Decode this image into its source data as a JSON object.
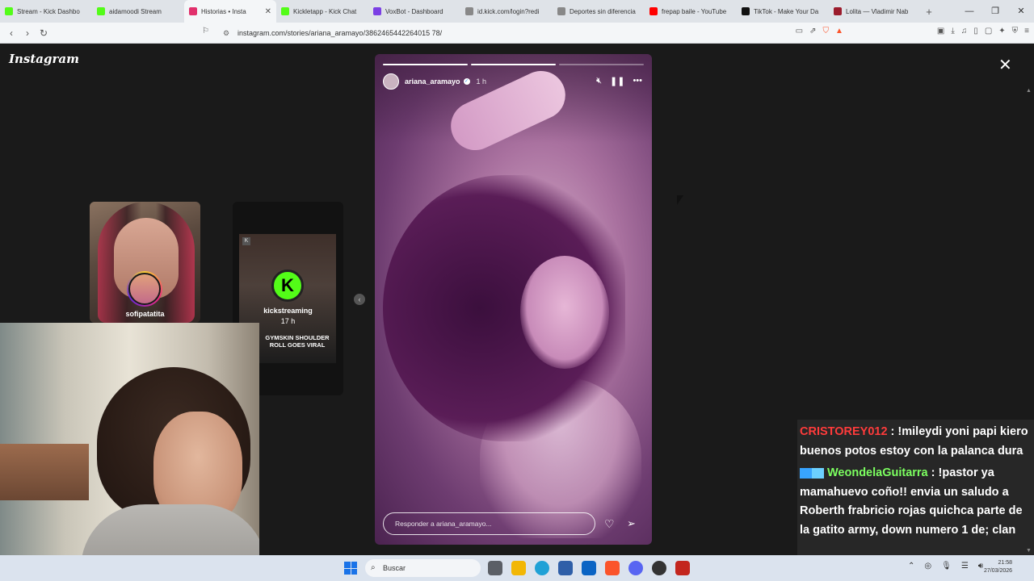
{
  "browser": {
    "tabs": [
      {
        "label": "Stream - Kick Dashbo",
        "color": "#53fc18",
        "active": false
      },
      {
        "label": "aidamoodi Stream",
        "color": "#53fc18",
        "active": false
      },
      {
        "label": "Historias • Insta",
        "color": "#e1306c",
        "active": true
      },
      {
        "label": "Kickletapp - Kick Chat",
        "color": "#53fc18",
        "active": false
      },
      {
        "label": "VoxBot - Dashboard",
        "color": "#7b3fe4",
        "active": false
      },
      {
        "label": "id.kick.com/login?redi",
        "color": "#888888",
        "active": false
      },
      {
        "label": "Deportes sin diferencia",
        "color": "#888888",
        "active": false
      },
      {
        "label": "frepap baile - YouTube",
        "color": "#ff0000",
        "active": false
      },
      {
        "label": "TikTok - Make Your Da",
        "color": "#111111",
        "active": false
      },
      {
        "label": "Lolita — Vladimir Nab",
        "color": "#9b1c2c",
        "active": false
      }
    ],
    "new_tab": "+",
    "url": "instagram.com/stories/ariana_aramayo/3862465442264015 78/"
  },
  "instagram": {
    "logo": "Instagram",
    "close": "✕",
    "prev_story": {
      "name": "sofipatatita"
    },
    "next_story": {
      "name": "kickstreaming",
      "time": "17 h",
      "caption": "GYMSKIN SHOULDER ROLL GOES VIRAL"
    },
    "story": {
      "username": "ariana_aramayo",
      "time": "1 h",
      "reply_placeholder": "Responder a ariana_aramayo...",
      "progress": [
        1.0,
        1.0,
        0.0
      ]
    }
  },
  "chat": {
    "messages": [
      {
        "user": "CRISTOREY012",
        "text": "!mileydi yoni papi kiero buenos potos estoy con la palanca dura"
      },
      {
        "user": "WeondelaGuitarra",
        "text": "!pastor ya mamahuevo coño!! envia un saludo a Roberth frabricio rojas quichca parte de la gatito army, down numero 1 de; clan"
      }
    ]
  },
  "taskbar": {
    "search": "Buscar",
    "time": "21:58",
    "date": "27/03/2026"
  }
}
